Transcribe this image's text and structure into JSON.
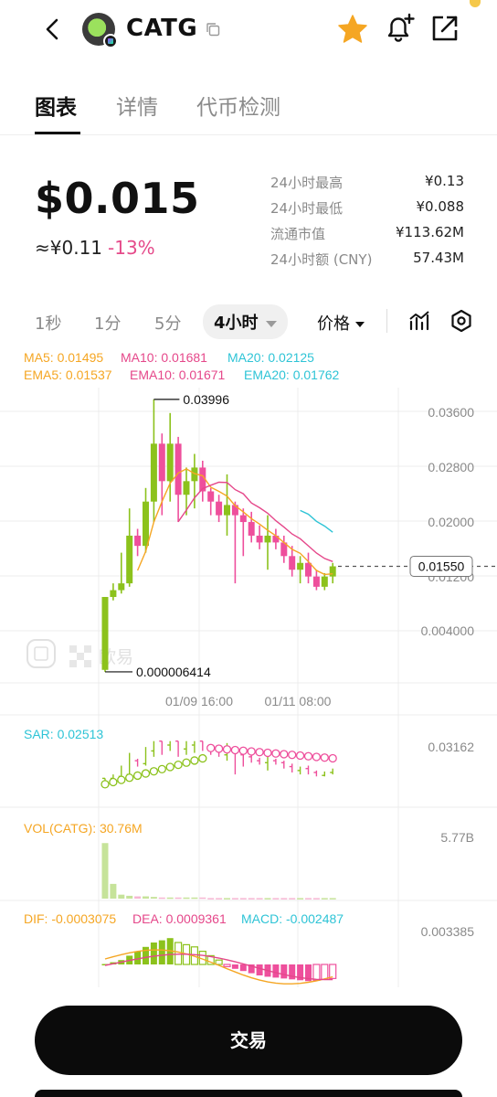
{
  "header": {
    "token_symbol": "CATG"
  },
  "tabs": [
    {
      "label": "图表",
      "active": true
    },
    {
      "label": "详情",
      "active": false
    },
    {
      "label": "代币检测",
      "active": false
    }
  ],
  "price": {
    "usd": "$0.015",
    "cny": "≈¥0.11",
    "change": "-13%"
  },
  "stats": [
    {
      "label": "24小时最高",
      "value": "¥0.13"
    },
    {
      "label": "24小时最低",
      "value": "¥0.088"
    },
    {
      "label": "流通市值",
      "value": "¥113.62M"
    },
    {
      "label": "24小时额 (CNY)",
      "value": "57.43M"
    }
  ],
  "timeframes": [
    {
      "label": "1秒",
      "active": false
    },
    {
      "label": "1分",
      "active": false
    },
    {
      "label": "5分",
      "active": false
    },
    {
      "label": "4小时",
      "active": true
    }
  ],
  "price_type": "价格",
  "indicators": {
    "ma": [
      {
        "text": "MA5: 0.01495",
        "color": "#f5a623"
      },
      {
        "text": "MA10: 0.01681",
        "color": "#e5478a"
      },
      {
        "text": "MA20: 0.02125",
        "color": "#2ec4d6"
      }
    ],
    "ema": [
      {
        "text": "EMA5: 0.01537",
        "color": "#f5a623"
      },
      {
        "text": "EMA10: 0.01671",
        "color": "#e5478a"
      },
      {
        "text": "EMA20: 0.01762",
        "color": "#2ec4d6"
      }
    ],
    "sar": "SAR: 0.02513",
    "vol": "VOL(CATG): 30.76M",
    "macd": [
      {
        "text": "DIF: -0.0003075",
        "color": "#f5a623"
      },
      {
        "text": "DEA: 0.0009361",
        "color": "#e5478a"
      },
      {
        "text": "MACD: -0.002487",
        "color": "#2ec4d6"
      }
    ]
  },
  "chart_data": {
    "type": "candlestick",
    "y_ticks": [
      "0.03600",
      "0.02800",
      "0.02000",
      "0.01200",
      "0.004000"
    ],
    "x_ticks": [
      "01/09 16:00",
      "01/11 08:00"
    ],
    "current_price": "0.01550",
    "max_label": "0.03996",
    "min_label": "0.000006414",
    "ylim": [
      0.0,
      0.042
    ],
    "colors": {
      "up": "#8cc21c",
      "down": "#ee4f9c",
      "ma5": "#f5a623",
      "ma10": "#e5478a",
      "ma20": "#2ec4d6"
    },
    "candles": [
      {
        "o": 0.0003,
        "h": 0.011,
        "l": 6.414e-06,
        "c": 0.011
      },
      {
        "o": 0.011,
        "h": 0.013,
        "l": 0.0105,
        "c": 0.012
      },
      {
        "o": 0.012,
        "h": 0.0175,
        "l": 0.0115,
        "c": 0.013
      },
      {
        "o": 0.013,
        "h": 0.024,
        "l": 0.0125,
        "c": 0.02
      },
      {
        "o": 0.02,
        "h": 0.021,
        "l": 0.017,
        "c": 0.0185
      },
      {
        "o": 0.0185,
        "h": 0.027,
        "l": 0.0175,
        "c": 0.025
      },
      {
        "o": 0.025,
        "h": 0.04,
        "l": 0.022,
        "c": 0.0335
      },
      {
        "o": 0.0335,
        "h": 0.035,
        "l": 0.023,
        "c": 0.028
      },
      {
        "o": 0.028,
        "h": 0.038,
        "l": 0.025,
        "c": 0.0335
      },
      {
        "o": 0.0335,
        "h": 0.0345,
        "l": 0.022,
        "c": 0.026
      },
      {
        "o": 0.026,
        "h": 0.03,
        "l": 0.023,
        "c": 0.028
      },
      {
        "o": 0.028,
        "h": 0.032,
        "l": 0.024,
        "c": 0.03
      },
      {
        "o": 0.03,
        "h": 0.031,
        "l": 0.025,
        "c": 0.0265
      },
      {
        "o": 0.0265,
        "h": 0.027,
        "l": 0.023,
        "c": 0.025
      },
      {
        "o": 0.025,
        "h": 0.026,
        "l": 0.022,
        "c": 0.023
      },
      {
        "o": 0.023,
        "h": 0.029,
        "l": 0.02,
        "c": 0.0245
      },
      {
        "o": 0.0245,
        "h": 0.025,
        "l": 0.013,
        "c": 0.023
      },
      {
        "o": 0.023,
        "h": 0.024,
        "l": 0.017,
        "c": 0.022
      },
      {
        "o": 0.022,
        "h": 0.0235,
        "l": 0.019,
        "c": 0.02
      },
      {
        "o": 0.02,
        "h": 0.0215,
        "l": 0.018,
        "c": 0.019
      },
      {
        "o": 0.019,
        "h": 0.023,
        "l": 0.015,
        "c": 0.02
      },
      {
        "o": 0.02,
        "h": 0.021,
        "l": 0.018,
        "c": 0.019
      },
      {
        "o": 0.019,
        "h": 0.02,
        "l": 0.016,
        "c": 0.017
      },
      {
        "o": 0.017,
        "h": 0.0185,
        "l": 0.014,
        "c": 0.015
      },
      {
        "o": 0.015,
        "h": 0.017,
        "l": 0.013,
        "c": 0.016
      },
      {
        "o": 0.016,
        "h": 0.0175,
        "l": 0.013,
        "c": 0.014
      },
      {
        "o": 0.014,
        "h": 0.015,
        "l": 0.012,
        "c": 0.0125
      },
      {
        "o": 0.0125,
        "h": 0.0145,
        "l": 0.012,
        "c": 0.014
      },
      {
        "o": 0.014,
        "h": 0.016,
        "l": 0.013,
        "c": 0.0155
      }
    ],
    "volume_label": "5.77B",
    "volume": [
      0.98,
      0.26,
      0.07,
      0.05,
      0.04,
      0.04,
      0.03,
      0.02,
      0.02,
      0.02,
      0.02,
      0.02,
      0.02,
      0.01,
      0.01,
      0.01,
      0.01,
      0.01,
      0.01,
      0.01,
      0.01,
      0.01,
      0.01,
      0.01,
      0.01,
      0.01,
      0.01,
      0.01,
      0.01
    ],
    "sar_label": "0.03162",
    "macd_label": "0.003385"
  },
  "watermark": "欧易",
  "trade_button": "交易"
}
